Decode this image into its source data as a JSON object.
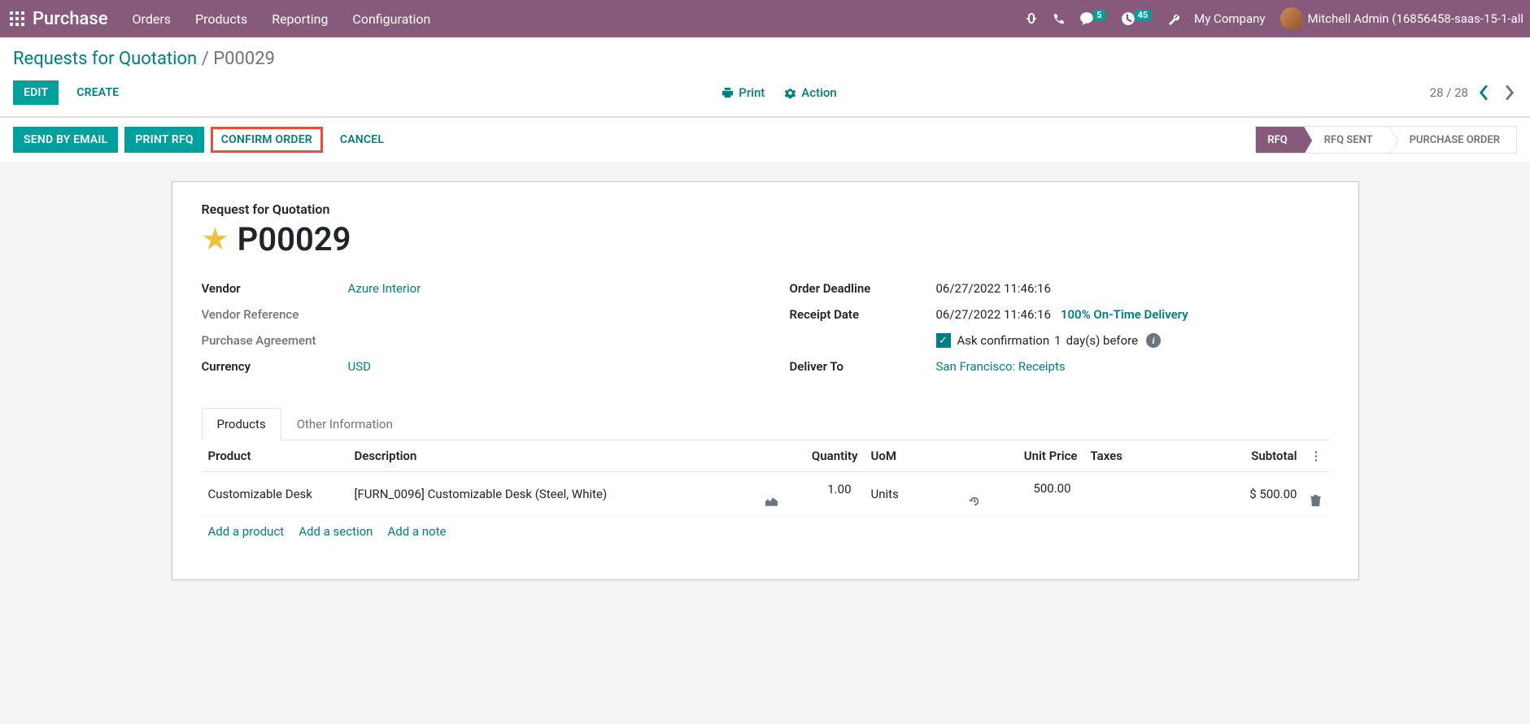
{
  "nav": {
    "brand": "Purchase",
    "menu": [
      "Orders",
      "Products",
      "Reporting",
      "Configuration"
    ],
    "chat_badge": "5",
    "activity_badge": "45",
    "company": "My Company",
    "user": "Mitchell Admin (16856458-saas-15-1-all"
  },
  "breadcrumb": {
    "parent": "Requests for Quotation",
    "current": "P00029"
  },
  "cp": {
    "edit": "Edit",
    "create": "Create",
    "print": "Print",
    "action": "Action",
    "pager": "28 / 28"
  },
  "statusbar": {
    "send_email": "Send by Email",
    "print_rfq": "Print RFQ",
    "confirm": "Confirm Order",
    "cancel": "Cancel",
    "steps": [
      "RFQ",
      "RFQ Sent",
      "Purchase Order"
    ]
  },
  "form": {
    "subtitle": "Request for Quotation",
    "name": "P00029",
    "left": {
      "vendor_label": "Vendor",
      "vendor_value": "Azure Interior",
      "vendor_ref_label": "Vendor Reference",
      "agreement_label": "Purchase Agreement",
      "currency_label": "Currency",
      "currency_value": "USD"
    },
    "right": {
      "deadline_label": "Order Deadline",
      "deadline_value": "06/27/2022 11:46:16",
      "receipt_label": "Receipt Date",
      "receipt_value": "06/27/2022 11:46:16",
      "ontime": "100% On-Time Delivery",
      "ask_confirm_prefix": "Ask confirmation",
      "ask_confirm_days": "1",
      "ask_confirm_suffix": "day(s) before",
      "deliver_label": "Deliver To",
      "deliver_value": "San Francisco: Receipts"
    }
  },
  "tabs": {
    "products": "Products",
    "other": "Other Information"
  },
  "table": {
    "headers": {
      "product": "Product",
      "description": "Description",
      "qty": "Quantity",
      "uom": "UoM",
      "price": "Unit Price",
      "taxes": "Taxes",
      "subtotal": "Subtotal"
    },
    "rows": [
      {
        "product": "Customizable Desk",
        "description": "[FURN_0096] Customizable Desk (Steel, White)",
        "qty": "1.00",
        "uom": "Units",
        "price": "500.00",
        "taxes": "",
        "subtotal": "$ 500.00"
      }
    ],
    "add_product": "Add a product",
    "add_section": "Add a section",
    "add_note": "Add a note"
  }
}
